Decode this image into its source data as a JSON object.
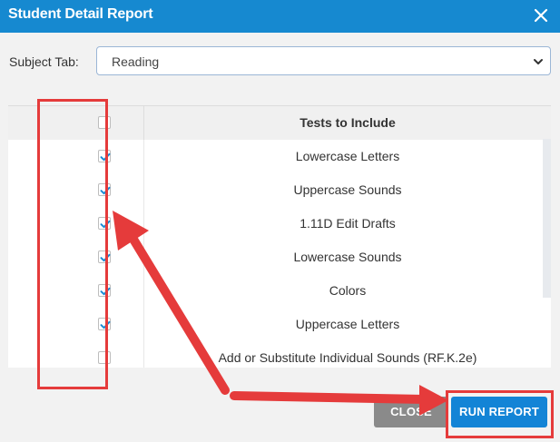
{
  "dialog": {
    "title": "Student Detail Report",
    "close_icon": "close-icon"
  },
  "subject": {
    "label": "Subject Tab:",
    "value": "Reading"
  },
  "table": {
    "header": "Tests to Include",
    "select_all_checked": false,
    "rows": [
      {
        "label": "Lowercase Letters",
        "checked": true
      },
      {
        "label": "Uppercase Sounds",
        "checked": true
      },
      {
        "label": "1.11D Edit Drafts",
        "checked": true
      },
      {
        "label": "Lowercase Sounds",
        "checked": true
      },
      {
        "label": "Colors",
        "checked": true
      },
      {
        "label": "Uppercase Letters",
        "checked": true
      },
      {
        "label": "Add or Substitute Individual Sounds (RF.K.2e)",
        "checked": false
      }
    ]
  },
  "buttons": {
    "close": "CLOSE",
    "run_report": "RUN REPORT"
  },
  "colors": {
    "titlebar": "#1689d0",
    "annotation": "#e53b3b",
    "primary_button": "#1384d6",
    "check": "#1a8ad4"
  }
}
